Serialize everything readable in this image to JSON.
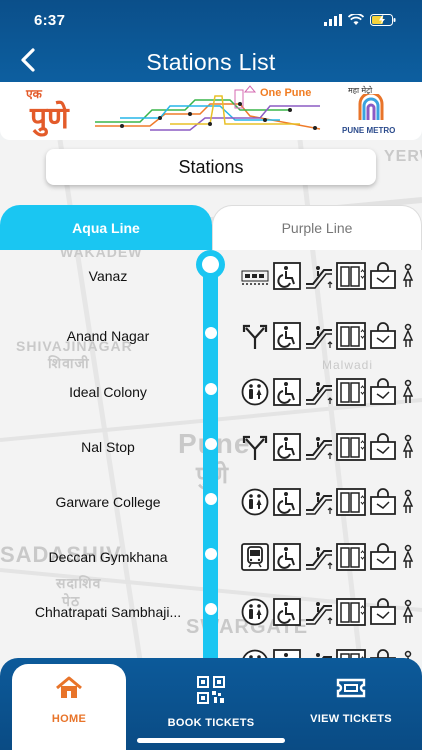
{
  "status_bar": {
    "time": "6:37"
  },
  "header": {
    "title": "Stations List"
  },
  "banner": {
    "ek": "एक",
    "pune_devanagari": "पुणे",
    "one_pune": "One Pune",
    "maha_metro": "महा मेट्रो",
    "pune_metro": "PUNE METRO"
  },
  "map_labels": {
    "wakadewadi": "WAKADEW",
    "shivajinagar": "SHIVAJINAGAR",
    "shivajinagar_dev": "शिवाजी",
    "malwadi": "Malwadi",
    "pune": "Pune",
    "pune_dev": "पुणे",
    "sadashiv": "SADASHIV",
    "sadashiv_dev": "सदाशिव",
    "peth_dev": "पेठ",
    "swargate": "SWARGATE",
    "yerw": "YERW"
  },
  "stations_button": {
    "label": "Stations"
  },
  "tabs": [
    {
      "label": "Aqua Line",
      "active": true
    },
    {
      "label": "Purple Line",
      "active": false
    }
  ],
  "colors": {
    "header": "#0b4f8a",
    "aqua": "#1ac6f2",
    "home_active": "#e8742a"
  },
  "stations": [
    {
      "name": "Vanaz",
      "amenities": [
        "train-depot-icon",
        "wheelchair-icon",
        "escalator-icon",
        "elevator-icon",
        "shopping-bag-icon",
        "washroom-icon"
      ]
    },
    {
      "name": "Anand Nagar",
      "amenities": [
        "route-split-icon",
        "wheelchair-icon",
        "escalator-icon",
        "elevator-icon",
        "shopping-bag-icon",
        "washroom-icon"
      ]
    },
    {
      "name": "Ideal Colony",
      "amenities": [
        "restroom-icon",
        "wheelchair-icon",
        "escalator-icon",
        "elevator-icon",
        "shopping-bag-icon",
        "washroom-icon"
      ]
    },
    {
      "name": "Nal Stop",
      "amenities": [
        "route-split-icon",
        "wheelchair-icon",
        "escalator-icon",
        "elevator-icon",
        "shopping-bag-icon",
        "washroom-icon"
      ]
    },
    {
      "name": "Garware College",
      "amenities": [
        "restroom-icon",
        "wheelchair-icon",
        "escalator-icon",
        "elevator-icon",
        "shopping-bag-icon",
        "washroom-icon"
      ]
    },
    {
      "name": "Deccan Gymkhana",
      "amenities": [
        "train-front-icon",
        "wheelchair-icon",
        "escalator-icon",
        "elevator-icon",
        "shopping-bag-icon",
        "washroom-icon"
      ]
    },
    {
      "name": "Chhatrapati Sambhaji...",
      "amenities": [
        "restroom-icon",
        "wheelchair-icon",
        "escalator-icon",
        "elevator-icon",
        "shopping-bag-icon",
        "washroom-icon"
      ]
    }
  ],
  "bottom_nav": [
    {
      "label": "HOME",
      "icon": "home-icon",
      "active": true
    },
    {
      "label": "BOOK TICKETS",
      "icon": "qr-code-icon",
      "active": false
    },
    {
      "label": "VIEW TICKETS",
      "icon": "ticket-icon",
      "active": false
    }
  ]
}
